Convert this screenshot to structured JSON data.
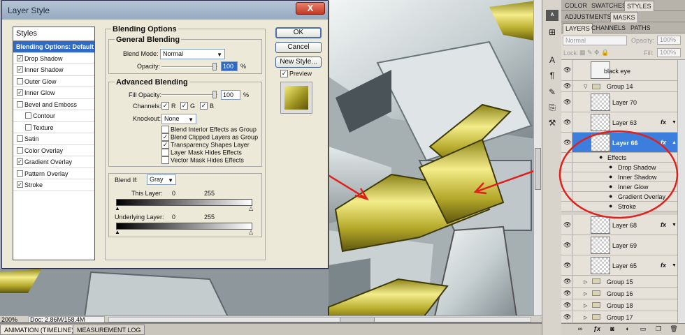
{
  "dialog": {
    "title": "Layer Style",
    "close_glyph": "X",
    "styles_header": "Styles",
    "styles": [
      {
        "label": "Blending Options: Default",
        "selected": true
      },
      {
        "label": "Drop Shadow",
        "checked": true
      },
      {
        "label": "Inner Shadow",
        "checked": true
      },
      {
        "label": "Outer Glow",
        "checked": false
      },
      {
        "label": "Inner Glow",
        "checked": true
      },
      {
        "label": "Bevel and Emboss",
        "checked": false
      },
      {
        "label": "Contour",
        "checked": false,
        "indent": true
      },
      {
        "label": "Texture",
        "checked": false,
        "indent": true
      },
      {
        "label": "Satin",
        "checked": false
      },
      {
        "label": "Color Overlay",
        "checked": false
      },
      {
        "label": "Gradient Overlay",
        "checked": true
      },
      {
        "label": "Pattern Overlay",
        "checked": false
      },
      {
        "label": "Stroke",
        "checked": true
      }
    ],
    "blending_options_title": "Blending Options",
    "general": {
      "title": "General Blending",
      "blend_mode_label": "Blend Mode:",
      "blend_mode_value": "Normal",
      "opacity_label": "Opacity:",
      "opacity_value": "100",
      "percent": "%"
    },
    "advanced": {
      "title": "Advanced Blending",
      "fill_opacity_label": "Fill Opacity:",
      "fill_opacity_value": "100",
      "percent": "%",
      "channels_label": "Channels:",
      "channel_r": "R",
      "channel_g": "G",
      "channel_b": "B",
      "knockout_label": "Knockout:",
      "knockout_value": "None",
      "options": [
        {
          "label": "Blend Interior Effects as Group",
          "checked": false
        },
        {
          "label": "Blend Clipped Layers as Group",
          "checked": true
        },
        {
          "label": "Transparency Shapes Layer",
          "checked": true
        },
        {
          "label": "Layer Mask Hides Effects",
          "checked": false
        },
        {
          "label": "Vector Mask Hides Effects",
          "checked": false
        }
      ]
    },
    "blend_if": {
      "label": "Blend If:",
      "value": "Gray",
      "this_layer_label": "This Layer:",
      "this_layer_low": "0",
      "this_layer_high": "255",
      "underlying_label": "Underlying Layer:",
      "underlying_low": "0",
      "underlying_high": "255"
    },
    "buttons": {
      "ok": "OK",
      "cancel": "Cancel",
      "new_style": "New Style...",
      "preview": "Preview"
    },
    "preview_checked": true
  },
  "canvas": {
    "zoom": "200%",
    "doc": "Doc: 2.86M/158.4M"
  },
  "bottom_tabs": {
    "animation": "ANIMATION (TIMELINE)",
    "measurement": "MEASUREMENT LOG"
  },
  "panels": {
    "top_tabs": [
      "COLOR",
      "SWATCHES",
      "STYLES"
    ],
    "mid_tabs": [
      "ADJUSTMENTS",
      "MASKS"
    ],
    "layer_tabs": [
      "LAYERS",
      "CHANNELS",
      "PATHS"
    ],
    "blend_mode": "Normal",
    "opacity_label": "Opacity:",
    "opacity_value": "100%",
    "lock_label": "Lock:",
    "fill_label": "Fill:",
    "fill_value": "100%"
  },
  "layers": {
    "black_eye": "black eye",
    "group14": "Group 14",
    "layer70": "Layer 70",
    "layer63": "Layer 63",
    "layer66": "Layer 66",
    "effects": "Effects",
    "fx_drop_shadow": "Drop Shadow",
    "fx_inner_shadow": "Inner Shadow",
    "fx_inner_glow": "Inner Glow",
    "fx_gradient_overlay": "Gradient Overlay",
    "fx_stroke": "Stroke",
    "layer68": "Layer 68",
    "layer69": "Layer 69",
    "layer65": "Layer 65",
    "group15": "Group 15",
    "group16": "Group 16",
    "group18": "Group 18",
    "group17": "Group 17",
    "fx": "fx"
  },
  "colors": {
    "selection_blue": "#3b7ede",
    "annotation_red": "#e0201c",
    "gold": "#b8ab2a"
  }
}
